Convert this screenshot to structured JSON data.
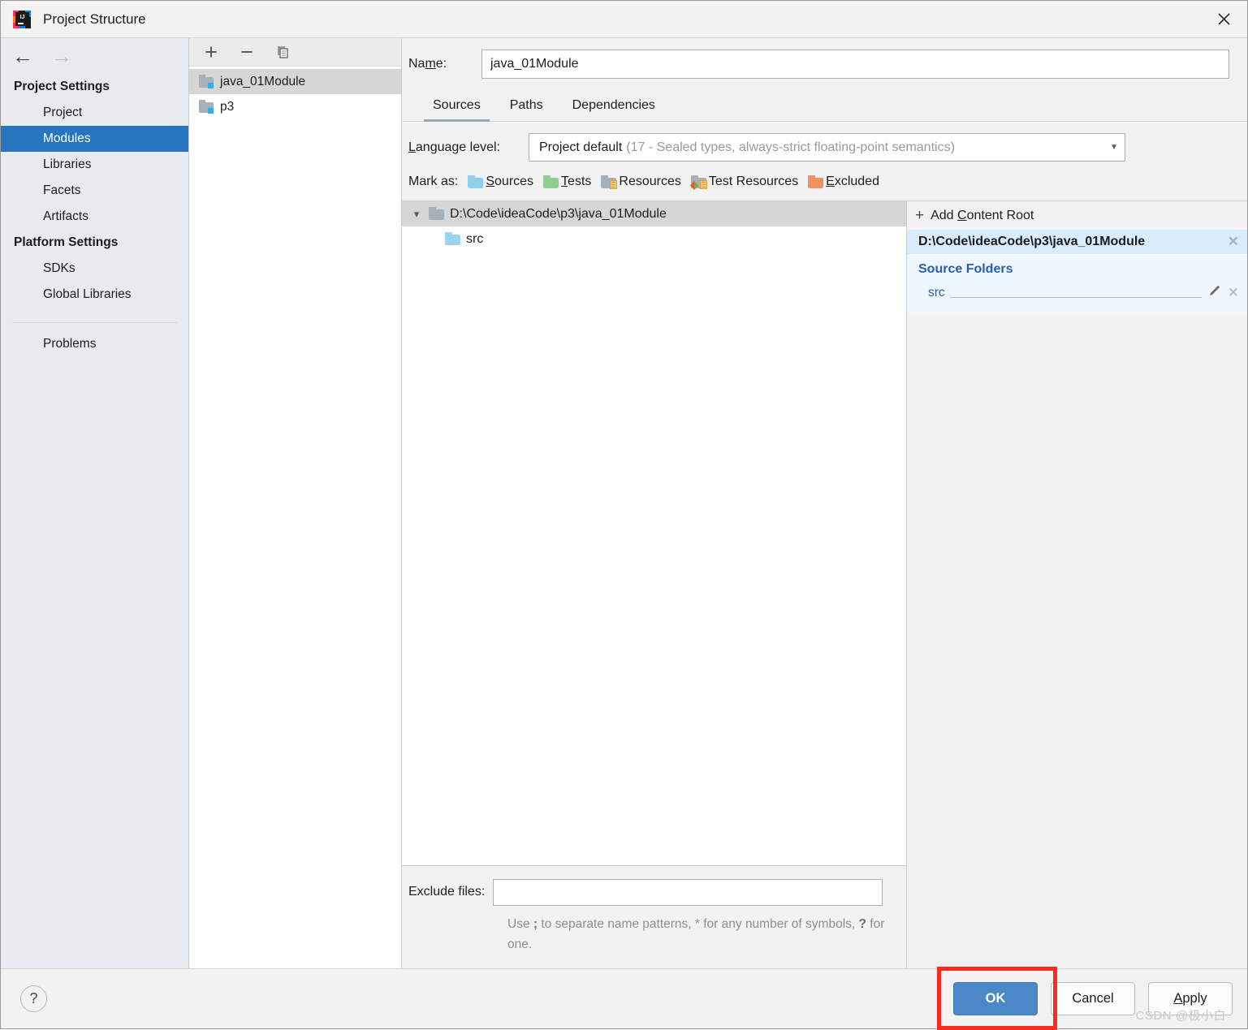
{
  "window": {
    "title": "Project Structure",
    "logo_icon": "intellij-idea-logo",
    "close_icon": "close-icon"
  },
  "nav": {
    "back_icon": "arrow-left-icon",
    "forward_icon": "arrow-right-icon"
  },
  "sidebar": {
    "groups": [
      {
        "title": "Project Settings",
        "items": [
          {
            "label": "Project",
            "selected": false
          },
          {
            "label": "Modules",
            "selected": true
          },
          {
            "label": "Libraries",
            "selected": false
          },
          {
            "label": "Facets",
            "selected": false
          },
          {
            "label": "Artifacts",
            "selected": false
          }
        ]
      },
      {
        "title": "Platform Settings",
        "items": [
          {
            "label": "SDKs",
            "selected": false
          },
          {
            "label": "Global Libraries",
            "selected": false
          }
        ]
      }
    ],
    "problems_label": "Problems",
    "selected_accent": "#2675bf"
  },
  "modules_panel": {
    "toolbar": {
      "add_icon": "plus-icon",
      "remove_icon": "minus-icon",
      "copy_icon": "copy-icon"
    },
    "items": [
      {
        "label": "java_01Module",
        "icon": "module-folder-icon",
        "selected": true
      },
      {
        "label": "p3",
        "icon": "module-folder-icon",
        "selected": false
      }
    ]
  },
  "module_editor": {
    "name_label": "Name:",
    "name_label_mnemonic": "m",
    "name_value": "java_01Module",
    "tabs": [
      {
        "label": "Sources",
        "active": true
      },
      {
        "label": "Paths",
        "active": false
      },
      {
        "label": "Dependencies",
        "active": false
      }
    ],
    "language_level": {
      "label": "Language level:",
      "value_strong": "Project default",
      "value_dim": "(17 - Sealed types, always-strict floating-point semantics)",
      "caret_icon": "chevron-down-icon"
    },
    "mark_as": {
      "label": "Mark as:",
      "options": [
        {
          "label": "Sources",
          "color": "#8fd0e8",
          "kind": "plain"
        },
        {
          "label": "Tests",
          "color": "#8fce8f",
          "kind": "plain"
        },
        {
          "label": "Resources",
          "color": "#a6b0b8",
          "kind": "lines"
        },
        {
          "label": "Test Resources",
          "color": "#a6b0b8",
          "kind": "lines-diamond"
        },
        {
          "label": "Excluded",
          "color": "#ef9163",
          "kind": "plain"
        }
      ]
    },
    "content_tree": {
      "root": {
        "label": "D:\\Code\\ideaCode\\p3\\java_01Module",
        "expanded": true,
        "icon": "folder-icon",
        "twisty_icon": "chevron-down-icon"
      },
      "children": [
        {
          "label": "src",
          "icon": "source-folder-icon"
        }
      ]
    },
    "exclude": {
      "label": "Exclude files:",
      "value": "",
      "placeholder": "",
      "hint_line1_a": "Use ",
      "hint_line1_sep": ";",
      "hint_line1_b": " to separate name patterns, * for any number of",
      "hint_line2_a": "symbols, ",
      "hint_line2_q": "?",
      "hint_line2_b": " for one.",
      "hint_full": "Use ; to separate name patterns, * for any number of symbols, ? for one."
    },
    "roots_panel": {
      "add_content_root_label": "Add Content Root",
      "add_icon": "plus-icon",
      "content_root": "D:\\Code\\ideaCode\\p3\\java_01Module",
      "content_root_remove_icon": "close-icon",
      "source_folders_title": "Source Folders",
      "source_folders": [
        {
          "name": "src",
          "edit_icon": "pencil-icon",
          "remove_icon": "close-icon"
        }
      ],
      "accent_color": "#2a5db0"
    }
  },
  "footer": {
    "help_label": "?",
    "help_icon": "help-icon",
    "ok_label": "OK",
    "cancel_label": "Cancel",
    "apply_label": "Apply",
    "apply_mnemonic": "A",
    "highlight_color": "#fb2c1e",
    "primary_color": "#4a88c7"
  },
  "watermark": "CSDN @极小白"
}
